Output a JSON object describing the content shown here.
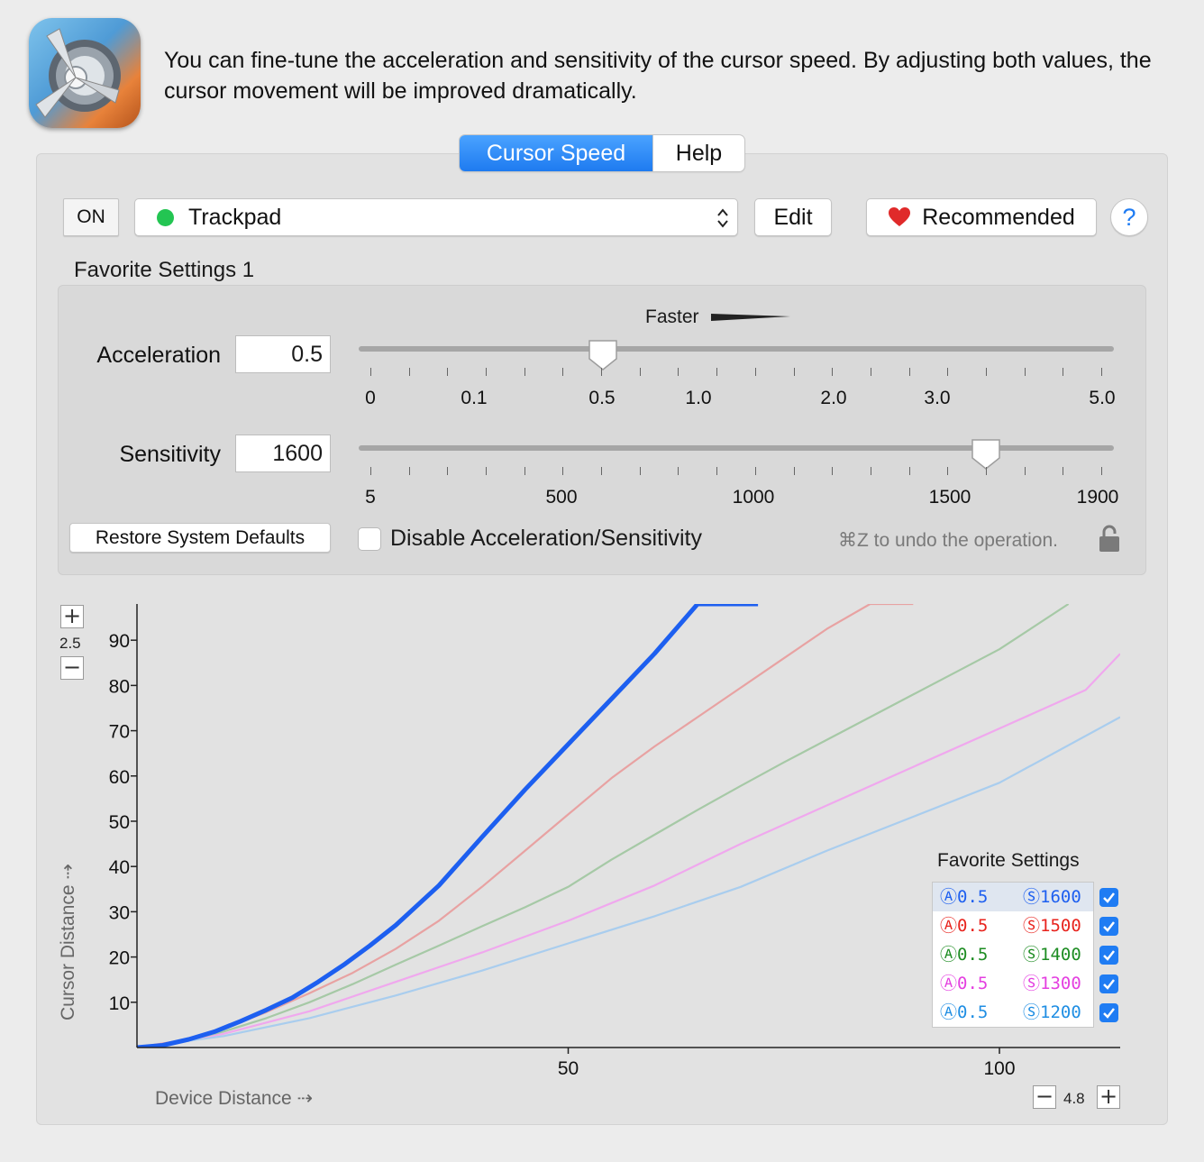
{
  "intro": {
    "text": "You can fine-tune the acceleration and sensitivity of the cursor speed. By adjusting both values, the cursor movement will be improved dramatically."
  },
  "tabs": [
    {
      "label": "Cursor Speed",
      "active": true
    },
    {
      "label": "Help",
      "active": false
    }
  ],
  "toolbar": {
    "on_label": "ON",
    "device": "Trackpad",
    "device_status_color": "#23c552",
    "edit_label": "Edit",
    "recommended_label": "Recommended",
    "help_label": "?"
  },
  "favorite": {
    "title": "Favorite Settings 1",
    "faster_label": "Faster",
    "acceleration": {
      "label": "Acceleration",
      "value": "0.5",
      "ticks": [
        "0",
        "0.1",
        "0.5",
        "1.0",
        "2.0",
        "3.0",
        "5.0"
      ]
    },
    "sensitivity": {
      "label": "Sensitivity",
      "value": "1600",
      "ticks": [
        "5",
        "500",
        "1000",
        "1500",
        "1900"
      ]
    },
    "restore_label": "Restore System Defaults",
    "disable_label": "Disable Acceleration/Sensitivity",
    "disable_checked": false,
    "undo_hint": "⌘Z to undo the operation."
  },
  "chart_data": {
    "type": "line",
    "xlabel": "Device Distance ⇢",
    "ylabel": "Cursor Distance ⇢",
    "x_ticks": [
      50,
      100
    ],
    "y_ticks": [
      10,
      20,
      30,
      40,
      50,
      60,
      70,
      80,
      90
    ],
    "xlim": [
      0,
      114
    ],
    "ylim": [
      0,
      98
    ],
    "x_scale_label": "4.8",
    "y_scale_label": "2.5",
    "series": [
      {
        "name": "Ⓐ0.5 Ⓢ1600",
        "color": "#1d5ff0",
        "x": [
          0,
          3,
          6,
          9,
          12,
          15,
          18,
          21,
          24,
          27,
          30,
          35,
          40,
          45,
          50,
          55,
          60,
          65,
          72
        ],
        "y": [
          0,
          0.5,
          1.8,
          3.5,
          5.8,
          8.3,
          11,
          14.5,
          18.3,
          22.5,
          27,
          35.8,
          46.5,
          57,
          67,
          77,
          87,
          98,
          98
        ]
      },
      {
        "name": "Ⓐ0.5 Ⓢ1500",
        "color": "#e8a2a2",
        "x": [
          0,
          5,
          10,
          15,
          20,
          25,
          30,
          35,
          40,
          45,
          50,
          55,
          60,
          65,
          70,
          75,
          80,
          85,
          90
        ],
        "y": [
          0,
          1.5,
          4.2,
          7.8,
          12,
          16.5,
          21.8,
          28,
          35.5,
          43.5,
          51.5,
          59.5,
          66.5,
          73,
          79.5,
          86,
          92.5,
          98,
          98
        ]
      },
      {
        "name": "Ⓐ0.5 Ⓢ1400",
        "color": "#a6c9a6",
        "x": [
          0,
          5,
          10,
          15,
          20,
          25,
          30,
          35,
          40,
          45,
          50,
          55,
          60,
          65,
          70,
          75,
          80,
          85,
          90,
          95,
          100,
          108
        ],
        "y": [
          0,
          1.2,
          3.5,
          6.5,
          10,
          14,
          18.3,
          22.5,
          26.8,
          31,
          35.5,
          41.5,
          47,
          52.5,
          57.8,
          63,
          68,
          73,
          78,
          83,
          88,
          98
        ]
      },
      {
        "name": "Ⓐ0.5 Ⓢ1300",
        "color": "#f0a8ee",
        "x": [
          0,
          10,
          20,
          30,
          40,
          50,
          60,
          70,
          80,
          90,
          100,
          110,
          114
        ],
        "y": [
          0,
          3,
          8,
          14.5,
          21,
          28,
          35.8,
          45,
          53.5,
          62,
          70.5,
          79,
          87
        ]
      },
      {
        "name": "Ⓐ0.5 Ⓢ1200",
        "color": "#a9cdee",
        "x": [
          0,
          10,
          20,
          30,
          40,
          50,
          60,
          70,
          80,
          90,
          100,
          114
        ],
        "y": [
          0,
          2.5,
          6.5,
          11.5,
          17,
          23,
          29,
          35.5,
          43.5,
          51,
          58.5,
          73
        ]
      }
    ]
  },
  "legend": {
    "title": "Favorite Settings",
    "rows": [
      {
        "a": "Ⓐ0.5",
        "s": "Ⓢ1600",
        "color": "#1d5ff0",
        "checked": true
      },
      {
        "a": "Ⓐ0.5",
        "s": "Ⓢ1500",
        "color": "#e8231d",
        "checked": true
      },
      {
        "a": "Ⓐ0.5",
        "s": "Ⓢ1400",
        "color": "#1d8c22",
        "checked": true
      },
      {
        "a": "Ⓐ0.5",
        "s": "Ⓢ1300",
        "color": "#e43fe0",
        "checked": true
      },
      {
        "a": "Ⓐ0.5",
        "s": "Ⓢ1200",
        "color": "#1f8ee3",
        "checked": true
      }
    ]
  }
}
